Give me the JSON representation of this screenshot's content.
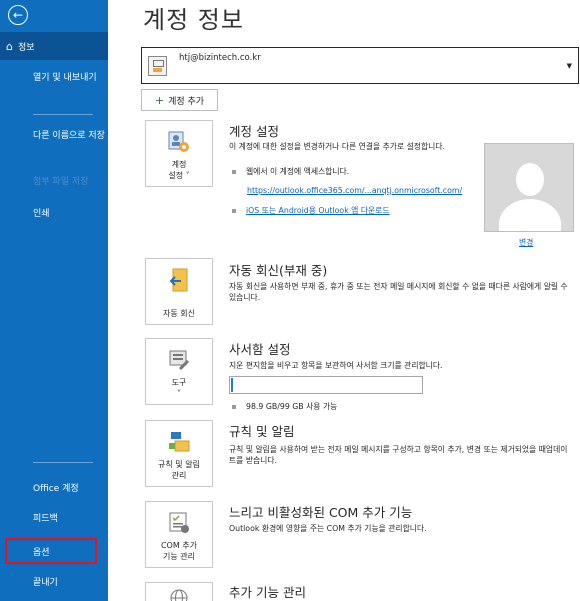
{
  "sidebar": {
    "back_icon": "back-arrow-icon",
    "home": "정보",
    "export": "열기 및 내보내기",
    "save_as": "다른 이름으로 저장",
    "save_attachments": "첨부 파일 저장",
    "print": "인쇄",
    "office_account": "Office 계정",
    "feedback": "피드백",
    "options": "옵션",
    "exit": "끝내기",
    "accent_color": "#106ebe",
    "highlight_color": "#e81123"
  },
  "page": {
    "title": "계정 정보"
  },
  "account": {
    "email": "htj@bizintech.co.kr"
  },
  "add_account": "계정 추가",
  "sections": {
    "account_settings": {
      "tile_line1": "계정",
      "tile_line2": "설정 ˅",
      "title": "계정 설정",
      "desc": "이 계정에 대한 설정을 변경하거나 다른 연결을 추가로 설정합니다.",
      "web_access": "웹에서 이 계정에 액세스합니다.",
      "web_link": "https://outlook.office365.com/...anqtj.onmicrosoft.com/",
      "mobile_link": "iOS 또는 Android용 Outlook 앱 다운로드",
      "change": "변경"
    },
    "auto_reply": {
      "tile_label": "자동 회신",
      "title": "자동 회신(부재 중)",
      "desc": "자동 회신을 사용하면 부재 중, 휴가 중 또는 전자 메일 메시지에 회신할 수 없을 때다른 사람에게 알릴 수 있습니다."
    },
    "mailbox": {
      "tile_line1": "도구",
      "tile_line2": "˅",
      "title": "사서함 설정",
      "desc": "지운 편지함을 비우고 항목을 보관하여 사서함 크기를 관리합니다.",
      "usage": "98.9 GB/99 GB 사용 가능",
      "used_fraction": 0.01
    },
    "rules": {
      "tile_line1": "규칙 및 알림",
      "tile_line2": "관리",
      "title": "규칙 및 알림",
      "desc": "규칙 및 알림을 사용하여 받는 전자 메일 메시지를 구성하고 항목이 추가, 변경 또는 제거되었을 때업데이트를 받습니다."
    },
    "com_addins": {
      "tile_line1": "COM 추가",
      "tile_line2": "기능 관리",
      "title": "느리고 비활성화된 COM 추가 기능",
      "desc": "Outlook 환경에 영향을 주는 COM 추가 기능을 관리합니다."
    },
    "addins": {
      "title": "추가 기능 관리"
    }
  }
}
